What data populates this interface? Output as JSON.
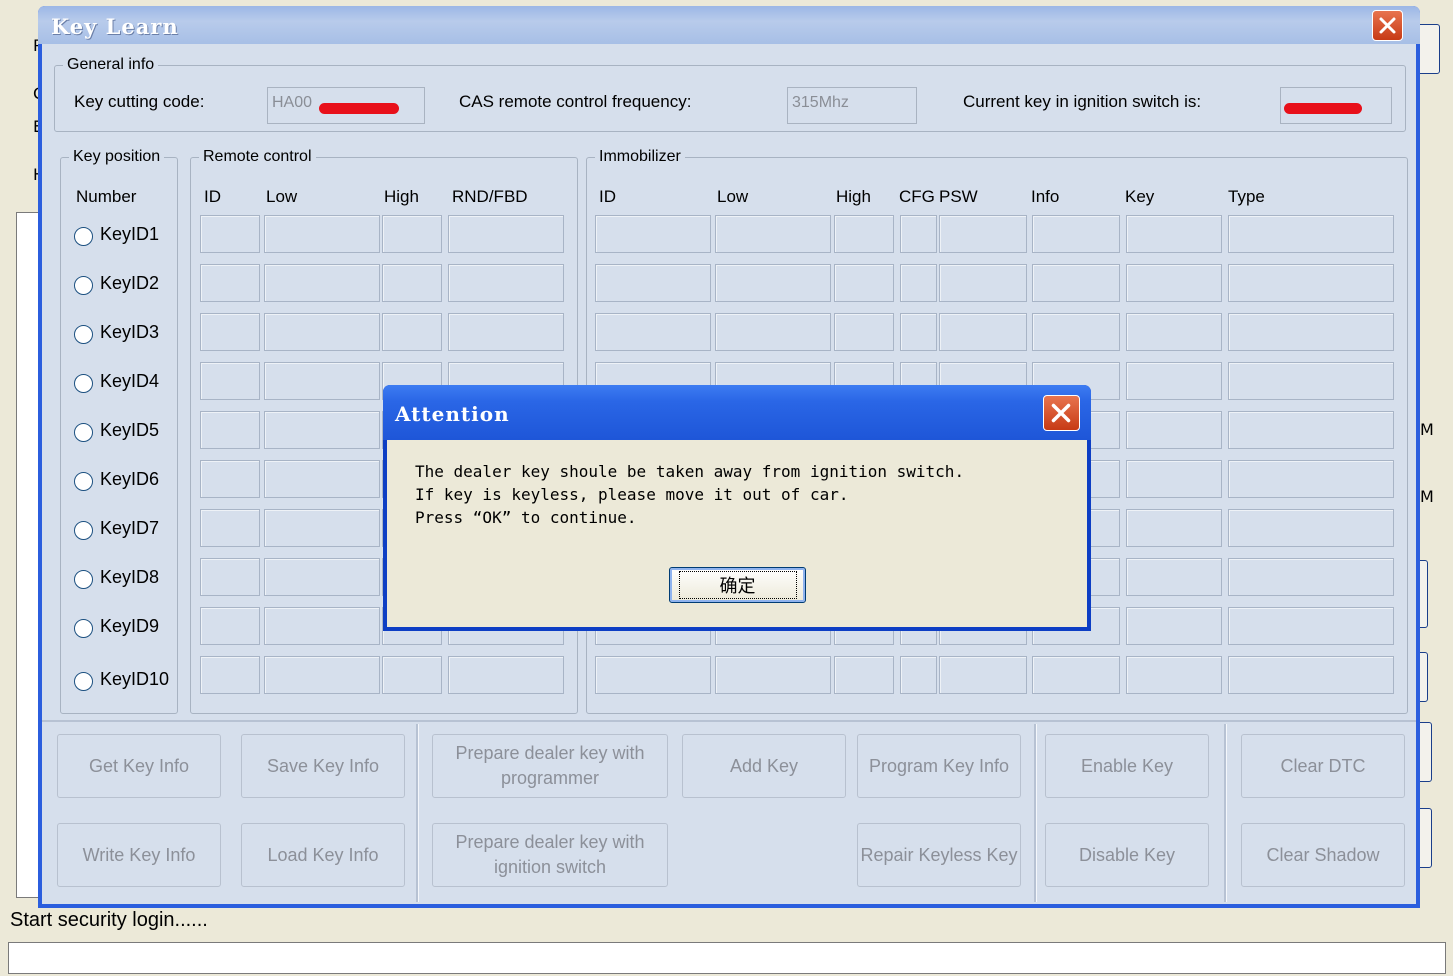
{
  "window": {
    "title": "Key Learn"
  },
  "general": {
    "legend": "General info",
    "cutting_label": "Key cutting code:",
    "cutting_value": "HA00",
    "freq_label": "CAS remote control frequency:",
    "freq_value": "315Mhz",
    "current_label": "Current key in ignition switch is:",
    "current_value": ""
  },
  "keypos": {
    "legend": "Key position",
    "header": "Number",
    "items": [
      "KeyID1",
      "KeyID2",
      "KeyID3",
      "KeyID4",
      "KeyID5",
      "KeyID6",
      "KeyID7",
      "KeyID8",
      "KeyID9",
      "KeyID10"
    ]
  },
  "remote": {
    "legend": "Remote control",
    "cols": [
      "ID",
      "Low",
      "High",
      "RND/FBD"
    ]
  },
  "immo": {
    "legend": "Immobilizer",
    "cols": [
      "ID",
      "Low",
      "High",
      "CFG",
      "PSW",
      "Info",
      "Key",
      "Type"
    ]
  },
  "buttons": {
    "get_key_info": "Get Key Info",
    "save_key_info": "Save Key Info",
    "prepare_programmer": "Prepare dealer key with programmer",
    "add_key": "Add Key",
    "program_key_info": "Program Key Info",
    "enable_key": "Enable Key",
    "clear_dtc": "Clear DTC",
    "write_key_info": "Write Key Info",
    "load_key_info": "Load Key Info",
    "prepare_ignition": "Prepare dealer key with ignition switch",
    "repair_keyless": "Repair Keyless Key",
    "disable_key": "Disable Key",
    "clear_shadow": "Clear Shadow"
  },
  "dialog": {
    "title": "Attention",
    "line1": "The dealer key shoule be taken away from ignition switch.",
    "line2": "If key is keyless, please move it out of car.",
    "line3": "Press “OK” to continue.",
    "ok": "确定"
  },
  "status": {
    "text": "Start security login......"
  },
  "background": {
    "frag_p": "P",
    "frag_c": "C",
    "frag_e": "E",
    "frag_h": "H",
    "frag_m1": "M",
    "frag_m2": "M"
  },
  "colors": {
    "title_active": "#2a66e6",
    "title_inactive": "#a7bfe6",
    "close_red": "#c73a15",
    "redaction": "#e8101a"
  }
}
